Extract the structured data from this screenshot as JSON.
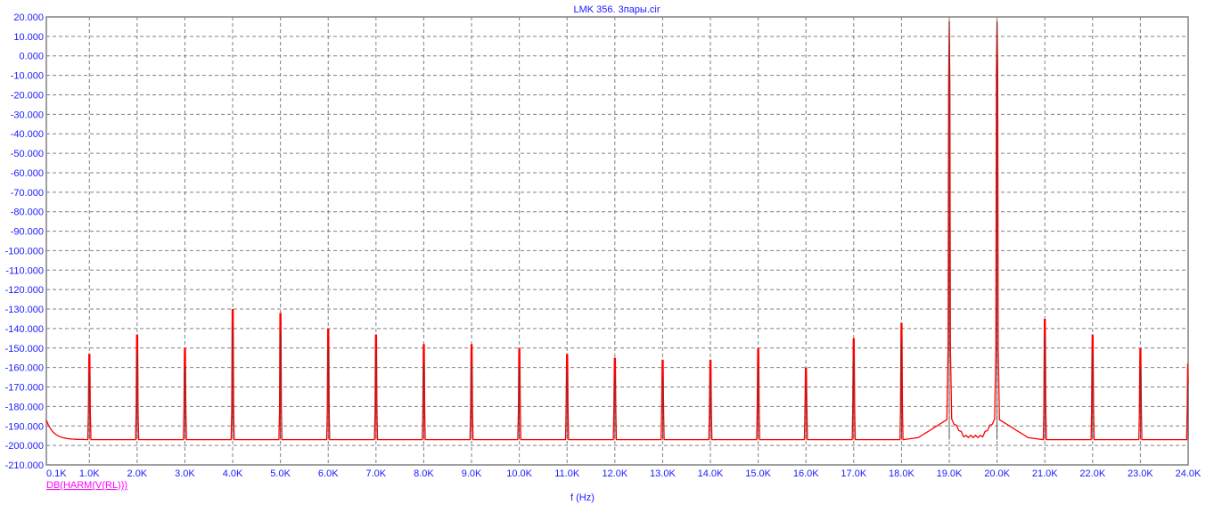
{
  "chart_data": {
    "type": "line",
    "title": "LMK 356. 3пары.cir",
    "xlabel": "f (Hz)",
    "ylabel": "",
    "xlim": [
      100,
      24000
    ],
    "ylim": [
      -210,
      20
    ],
    "grid": true,
    "x_ticks": [
      "0.1K",
      "1.0K",
      "2.0K",
      "3.0K",
      "4.0K",
      "5.0K",
      "6.0K",
      "7.0K",
      "8.0K",
      "9.0K",
      "10.0K",
      "11.0K",
      "12.0K",
      "13.0K",
      "14.0K",
      "15.0K",
      "16.0K",
      "17.0K",
      "18.0K",
      "19.0K",
      "20.0K",
      "21.0K",
      "22.0K",
      "23.0K",
      "24.0K"
    ],
    "x_tick_values": [
      100,
      1000,
      2000,
      3000,
      4000,
      5000,
      6000,
      7000,
      8000,
      9000,
      10000,
      11000,
      12000,
      13000,
      14000,
      15000,
      16000,
      17000,
      18000,
      19000,
      20000,
      21000,
      22000,
      23000,
      24000
    ],
    "y_ticks": [
      "20.000",
      "10.000",
      "0.000",
      "-10.000",
      "-20.000",
      "-30.000",
      "-40.000",
      "-50.000",
      "-60.000",
      "-70.000",
      "-80.000",
      "-90.000",
      "-100.000",
      "-110.000",
      "-120.000",
      "-130.000",
      "-140.000",
      "-150.000",
      "-160.000",
      "-170.000",
      "-180.000",
      "-190.000",
      "-200.000",
      "-210.000"
    ],
    "y_tick_values": [
      20,
      10,
      0,
      -10,
      -20,
      -30,
      -40,
      -50,
      -60,
      -70,
      -80,
      -90,
      -100,
      -110,
      -120,
      -130,
      -140,
      -150,
      -160,
      -170,
      -180,
      -190,
      -200,
      -210
    ],
    "series": [
      {
        "name": "DB(HARM(V(RL)))",
        "color": "#ff0000",
        "noise_floor_db": -197,
        "start_db": -187,
        "peaks": [
          {
            "f": 1000,
            "db": -163
          },
          {
            "f": 2000,
            "db": -153
          },
          {
            "f": 3000,
            "db": -160
          },
          {
            "f": 4000,
            "db": -140
          },
          {
            "f": 5000,
            "db": -142
          },
          {
            "f": 6000,
            "db": -150
          },
          {
            "f": 7000,
            "db": -153
          },
          {
            "f": 8000,
            "db": -158
          },
          {
            "f": 9000,
            "db": -158
          },
          {
            "f": 10000,
            "db": -160
          },
          {
            "f": 11000,
            "db": -163
          },
          {
            "f": 12000,
            "db": -165
          },
          {
            "f": 13000,
            "db": -166
          },
          {
            "f": 14000,
            "db": -166
          },
          {
            "f": 15000,
            "db": -160
          },
          {
            "f": 16000,
            "db": -170
          },
          {
            "f": 17000,
            "db": -155
          },
          {
            "f": 18000,
            "db": -147
          },
          {
            "f": 19000,
            "db": 18
          },
          {
            "f": 20000,
            "db": 18
          },
          {
            "f": 21000,
            "db": -145
          },
          {
            "f": 22000,
            "db": -153
          },
          {
            "f": 23000,
            "db": -160
          },
          {
            "f": 24000,
            "db": -168
          }
        ]
      }
    ],
    "legend": "bottom-left"
  }
}
